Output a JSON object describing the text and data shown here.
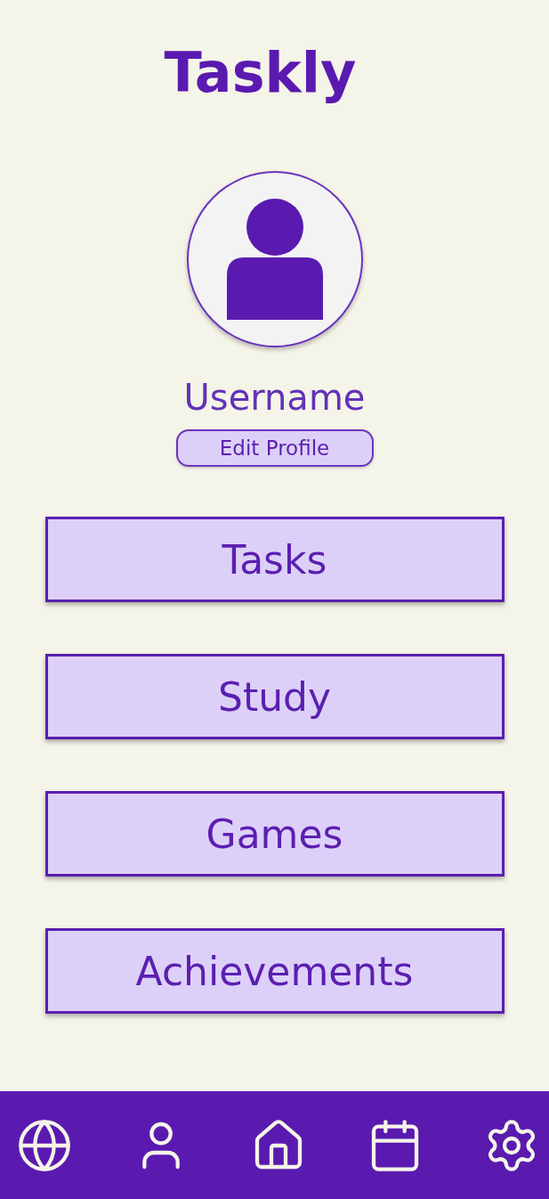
{
  "app_title": "Taskly",
  "profile": {
    "username": "Username",
    "edit_button": "Edit Profile"
  },
  "menu": [
    {
      "label": "Tasks"
    },
    {
      "label": "Study"
    },
    {
      "label": "Games"
    },
    {
      "label": "Achievements"
    }
  ]
}
